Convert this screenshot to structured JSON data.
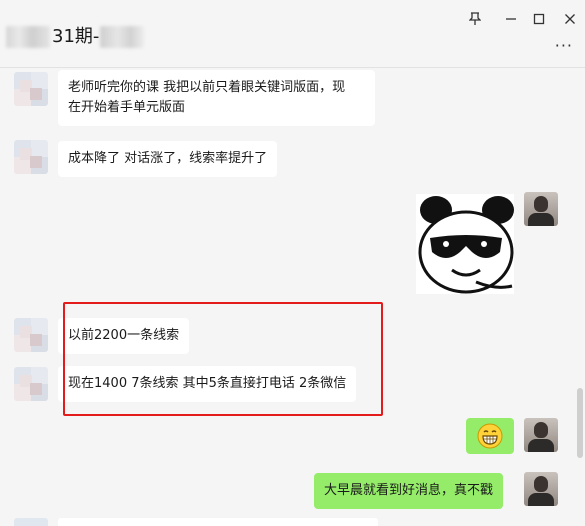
{
  "window": {
    "title": "31期-",
    "pin_icon": "pin-icon",
    "minimize_icon": "minimize-icon",
    "maximize_icon": "maximize-icon",
    "close_icon": "close-icon",
    "more_label": "···"
  },
  "messages": [
    {
      "side": "left",
      "text_line1": "老师听完你的课 我把以前只着眼关键词版面，现",
      "text_line2": "在开始着手单元版面"
    },
    {
      "side": "left",
      "text": "成本降了 对话涨了，线索率提升了"
    },
    {
      "side": "right",
      "type": "sticker",
      "icon": "panda-sunglasses-sticker"
    },
    {
      "side": "left",
      "text": "以前2200一条线索"
    },
    {
      "side": "left",
      "text": "现在1400  7条线索 其中5条直接打电话 2条微信"
    },
    {
      "side": "right",
      "type": "emoji",
      "icon": "grinning-face-emoji"
    },
    {
      "side": "right",
      "text": "大早晨就看到好消息，真不戳"
    }
  ],
  "colors": {
    "highlight_border": "#e31b1b",
    "self_bubble": "#95ec69",
    "other_bubble": "#ffffff",
    "background": "#f5f5f5"
  }
}
